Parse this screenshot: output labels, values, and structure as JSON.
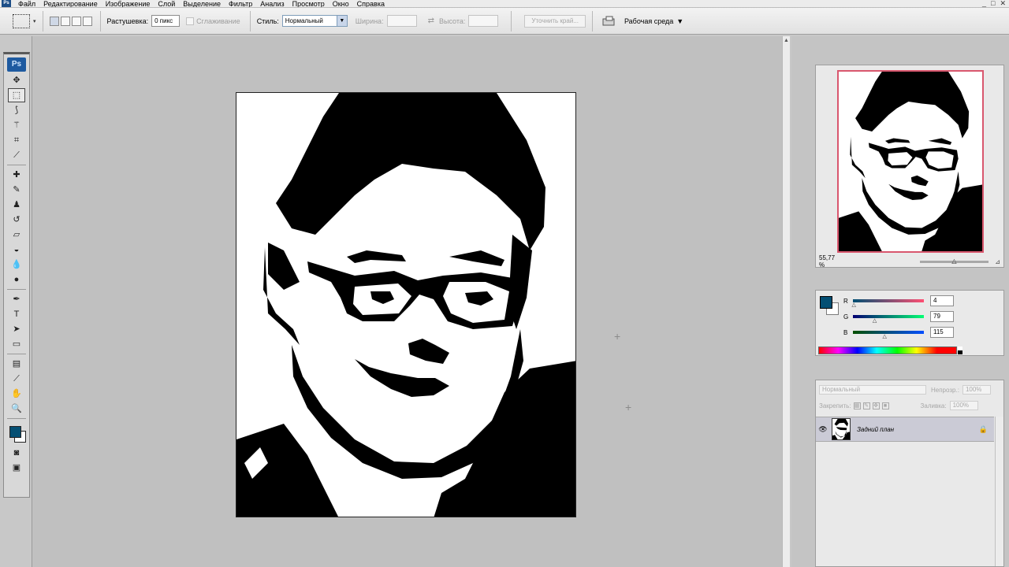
{
  "menubar": {
    "app_icon": "Ps",
    "items": [
      "Файл",
      "Редактирование",
      "Изображение",
      "Слой",
      "Выделение",
      "Фильтр",
      "Анализ",
      "Просмотр",
      "Окно",
      "Справка"
    ],
    "window_controls": [
      "_",
      "□",
      "✕"
    ]
  },
  "options_bar": {
    "feather_label": "Растушевка:",
    "feather_value": "0 пикс",
    "antialias_label": "Сглаживание",
    "style_label": "Стиль:",
    "style_value": "Нормальный",
    "width_label": "Ширина:",
    "height_label": "Высота:",
    "refine_edge_label": "Уточнить край...",
    "workspace_label": "Рабочая среда"
  },
  "toolbox": {
    "logo": "Ps",
    "tools": [
      {
        "icon": "move-icon",
        "glyph": "✥"
      },
      {
        "icon": "marquee-icon",
        "glyph": "⬚",
        "selected": true
      },
      {
        "icon": "lasso-icon",
        "glyph": "⟆"
      },
      {
        "icon": "magic-wand-icon",
        "glyph": "⚚"
      },
      {
        "icon": "crop-icon",
        "glyph": "⌗"
      },
      {
        "icon": "eyedropper-icon",
        "glyph": "⟋"
      },
      {
        "icon": "healing-brush-icon",
        "glyph": "✚"
      },
      {
        "icon": "brush-icon",
        "glyph": "✎"
      },
      {
        "icon": "clone-stamp-icon",
        "glyph": "♟"
      },
      {
        "icon": "history-brush-icon",
        "glyph": "↺"
      },
      {
        "icon": "eraser-icon",
        "glyph": "▱"
      },
      {
        "icon": "paint-bucket-icon",
        "glyph": "◒"
      },
      {
        "icon": "blur-icon",
        "glyph": "💧"
      },
      {
        "icon": "dodge-icon",
        "glyph": "●"
      },
      {
        "icon": "pen-icon",
        "glyph": "✒"
      },
      {
        "icon": "type-icon",
        "glyph": "T"
      },
      {
        "icon": "path-selection-icon",
        "glyph": "➤"
      },
      {
        "icon": "rectangle-shape-icon",
        "glyph": "▭"
      },
      {
        "icon": "notes-icon",
        "glyph": "▤"
      },
      {
        "icon": "color-sampler-icon",
        "glyph": "⟋"
      },
      {
        "icon": "hand-icon",
        "glyph": "✋"
      },
      {
        "icon": "zoom-icon",
        "glyph": "🔍"
      }
    ],
    "foreground_color": "#044f73",
    "background_color": "#ffffff"
  },
  "navigator": {
    "zoom": "55,77 %"
  },
  "color_panel": {
    "channels": [
      {
        "name": "R",
        "value": "4",
        "fraction": 0.016
      },
      {
        "name": "G",
        "value": "79",
        "fraction": 0.31
      },
      {
        "name": "B",
        "value": "115",
        "fraction": 0.45
      }
    ],
    "foreground_color": "#044f73"
  },
  "layers_panel": {
    "blend_mode": "Нормальный",
    "opacity_label": "Непрозр.:",
    "opacity_value": "100%",
    "lock_label": "Закрепить:",
    "fill_label": "Заливка:",
    "fill_value": "100%",
    "layers": [
      {
        "name": "Задний план",
        "visible": true,
        "locked": true
      }
    ]
  }
}
